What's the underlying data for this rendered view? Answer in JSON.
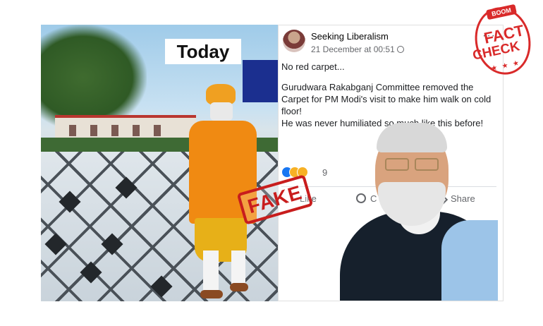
{
  "photo": {
    "caption": "Today",
    "stamp": "FAKE"
  },
  "post": {
    "author": "Seeking Liberalism",
    "date": "21 December at 00:51",
    "more": "···",
    "paragraphs": [
      "No red carpet...",
      "Gurudwara Rakabganj Committee removed the Carpet for PM Modi's visit to make him walk on cold floor!\nHe was never humiliated so much like this before!"
    ],
    "reaction_count": "9",
    "actions": {
      "like": "Like",
      "comment": "C",
      "share": "Share"
    }
  },
  "fact_check": {
    "brand": "BOOM",
    "line1": "FACT",
    "line2": "CHECK",
    "stars": "★ ★ ★"
  },
  "colors": {
    "stamp_red": "#c81d1d",
    "facebook_blue": "#1877f2",
    "kurta_orange": "#f08a12"
  }
}
